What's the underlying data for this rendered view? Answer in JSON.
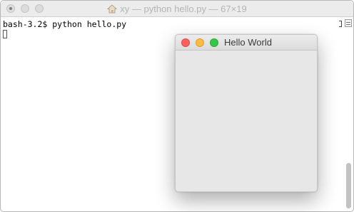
{
  "terminal": {
    "title": "xy — python hello.py — 67×19",
    "lines": [
      "bash-3.2$ python hello.py"
    ]
  },
  "tk_window": {
    "title": "Hello World"
  },
  "colors": {
    "close": "#fc605c",
    "minimize": "#fdbc40",
    "zoom": "#34c84a",
    "window_bg": "#e7e7e7"
  },
  "icons": {
    "terminal_title": "home-icon"
  }
}
